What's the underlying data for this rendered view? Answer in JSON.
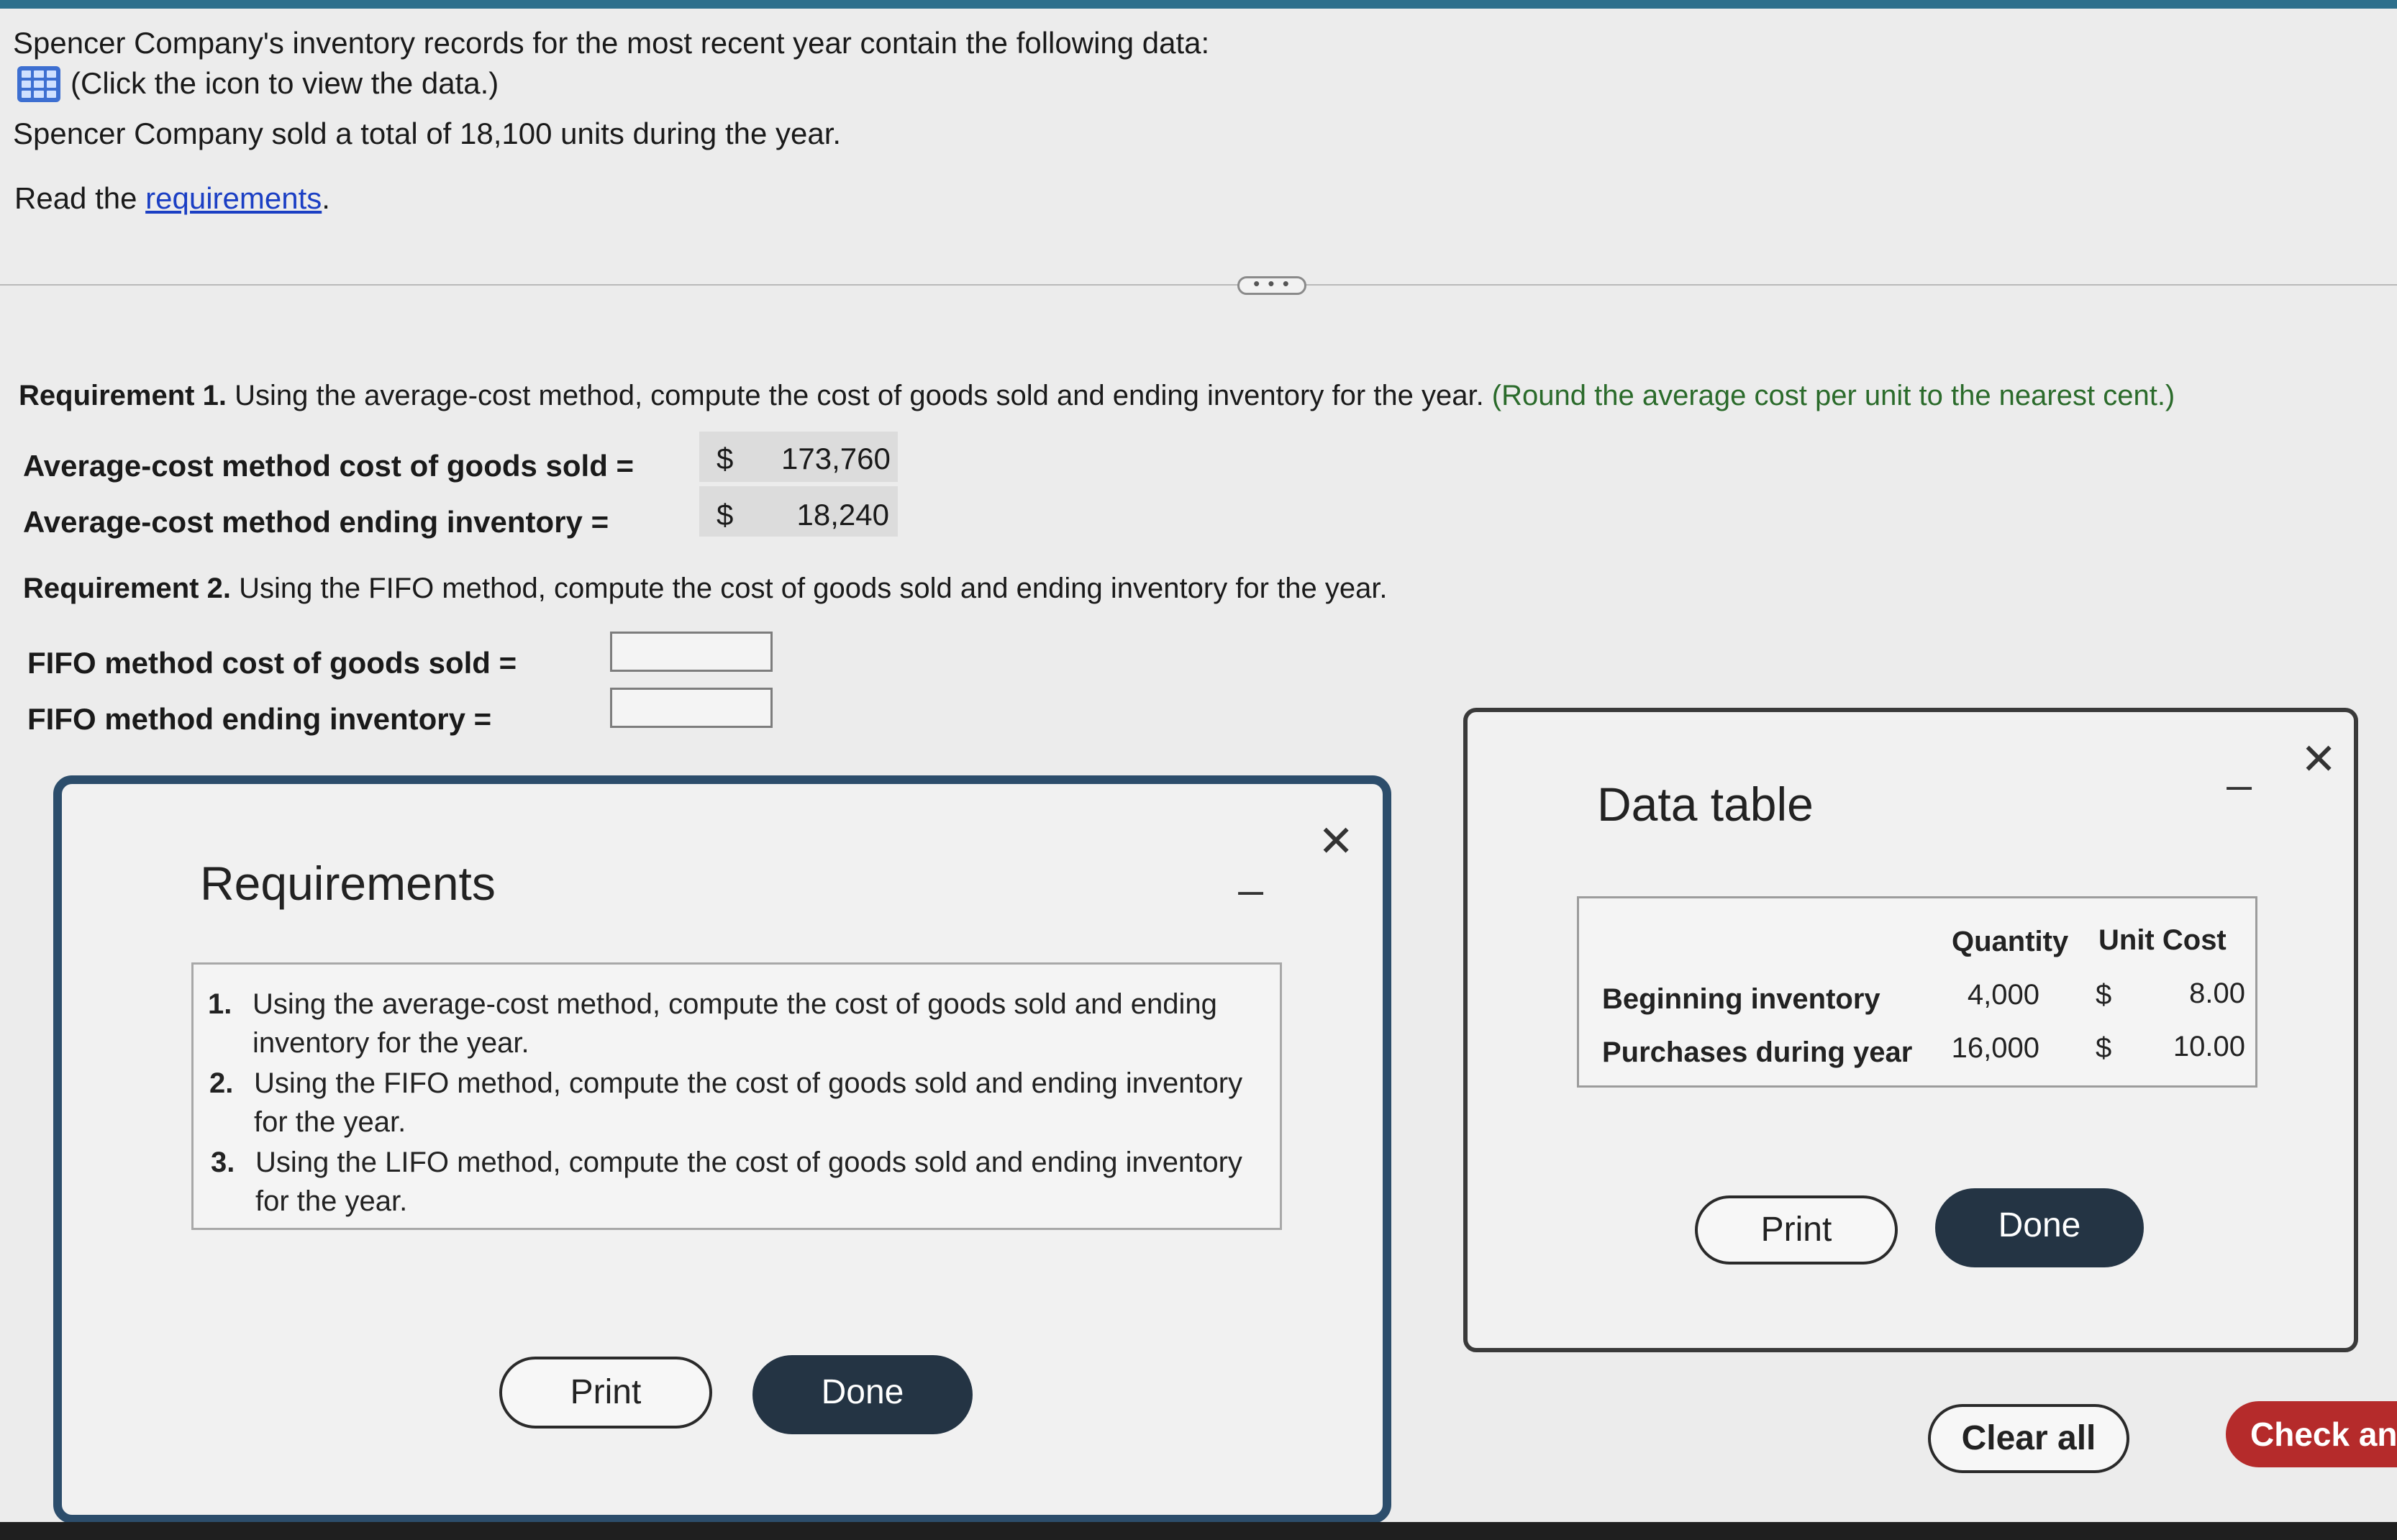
{
  "intro": {
    "line1": "Spencer Company's inventory records for the most recent year contain the following data:",
    "data_link": "(Click the icon to view the data.)",
    "line2": "Spencer Company sold a total of 18,100 units during the year.",
    "read_prefix": "Read the ",
    "read_link": "requirements",
    "read_suffix": "."
  },
  "expander": "• • •",
  "req1": {
    "heading_bold": "Requirement 1.",
    "heading_text": " Using the average-cost method, compute the cost of goods sold and ending inventory for the year.",
    "heading_hint": " (Round the average cost per unit to the nearest cent.)",
    "cogs_label": "Average-cost method cost of goods sold =",
    "cogs_currency": "$",
    "cogs_value": "173,760",
    "ei_label": "Average-cost method ending inventory =",
    "ei_currency": "$",
    "ei_value": "18,240"
  },
  "req2": {
    "heading_bold": "Requirement 2.",
    "heading_text": " Using the FIFO method, compute the cost of goods sold and ending inventory for the year.",
    "cogs_label": "FIFO method cost of goods sold =",
    "ei_label": "FIFO method ending inventory =",
    "cogs_value": "",
    "ei_value": ""
  },
  "requirements_modal": {
    "title": "Requirements",
    "minimize": "_",
    "close": "✕",
    "items": [
      {
        "num": "1.",
        "line1": "Using the average-cost method, compute the cost of goods sold and ending",
        "line2": "inventory for the year."
      },
      {
        "num": "2.",
        "line1": "Using the FIFO method, compute the cost of goods sold and ending inventory",
        "line2": "for the year."
      },
      {
        "num": "3.",
        "line1": "Using the LIFO method, compute the cost of goods sold and ending inventory",
        "line2": "for the year."
      }
    ],
    "print": "Print",
    "done": "Done"
  },
  "data_modal": {
    "title": "Data table",
    "minimize": "_",
    "close": "✕",
    "headers": {
      "quantity": "Quantity",
      "unit_cost": "Unit Cost"
    },
    "rows": [
      {
        "label": "Beginning inventory",
        "quantity": "4,000",
        "currency": "$",
        "unit_cost": "8.00"
      },
      {
        "label": "Purchases during year",
        "quantity": "16,000",
        "currency": "$",
        "unit_cost": "10.00"
      }
    ],
    "print": "Print",
    "done": "Done"
  },
  "footer": {
    "clear_all": "Clear all",
    "check_answer": "Check an"
  }
}
